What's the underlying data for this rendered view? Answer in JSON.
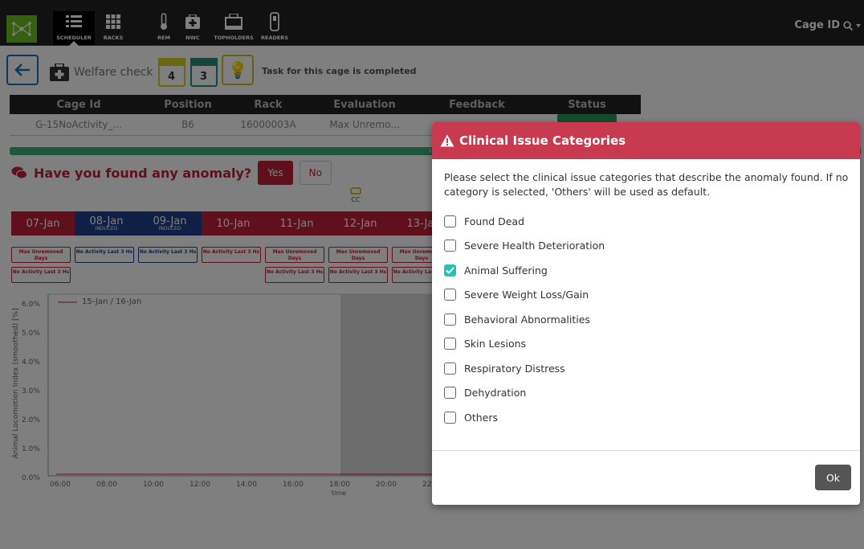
{
  "nav": {
    "items": [
      {
        "id": "scheduler",
        "label": "SCHEDULER",
        "icon": "list-icon",
        "active": true
      },
      {
        "id": "racks",
        "label": "RACKS",
        "icon": "grid-icon",
        "active": false
      },
      {
        "id": "rem",
        "label": "REM",
        "icon": "thermometer-icon",
        "active": false
      },
      {
        "id": "nwc",
        "label": "NWC",
        "icon": "medkit-icon",
        "active": false
      },
      {
        "id": "topholders",
        "label": "TOPHOLDERS",
        "icon": "topholder-icon",
        "active": false
      },
      {
        "id": "readers",
        "label": "READERS",
        "icon": "reader-icon",
        "active": false
      }
    ],
    "search_label": "Cage ID"
  },
  "toolbar": {
    "welfare_label": "Welfare check",
    "cal1": "4",
    "cal2": "3",
    "task_status": "Task for this cage is completed"
  },
  "cage_table": {
    "headers": [
      "Cage Id",
      "Position",
      "Rack",
      "Evaluation",
      "Feedback",
      "Status"
    ],
    "row": [
      "G-15NoActivity_...",
      "B6",
      "16000003A",
      "Max Unremo...",
      "",
      ""
    ]
  },
  "progress": {
    "value": 100,
    "label": "100%"
  },
  "anomaly": {
    "question": "Have you found any anomaly?",
    "yes": "Yes",
    "no": "No",
    "cc": "CC"
  },
  "days": [
    {
      "label": "07-Jan",
      "sub": "",
      "color": "red"
    },
    {
      "label": "08-Jan",
      "sub": "INDUCED",
      "color": "blue"
    },
    {
      "label": "09-Jan",
      "sub": "INDUCED",
      "color": "blue"
    },
    {
      "label": "10-Jan",
      "sub": "",
      "color": "red"
    },
    {
      "label": "11-Jan",
      "sub": "",
      "color": "red"
    },
    {
      "label": "12-Jan",
      "sub": "",
      "color": "red"
    },
    {
      "label": "13-Jan",
      "sub": "",
      "color": "red"
    }
  ],
  "tags": {
    "max_unremoved": "Max Unremoved Days",
    "no_activity": "No Activity Last 3 Hs"
  },
  "chart": {
    "legend": "15-Jan / 16-Jan",
    "ylabel": "Animal Locomotion Index (smoothed) [%]",
    "xlabel": "time",
    "yticks": [
      "6.0%",
      "5.0%",
      "4.0%",
      "3.0%",
      "2.0%",
      "1.0%",
      "0.0%"
    ],
    "xticks": [
      "06:00",
      "08:00",
      "10:00",
      "12:00",
      "14:00",
      "16:00",
      "18:00",
      "20:00",
      "22"
    ]
  },
  "modal": {
    "title": "Clinical Issue Categories",
    "description": "Please select the clinical issue categories that describe the anomaly found. If no category is selected, 'Others' will be used as default.",
    "options": [
      {
        "label": "Found Dead",
        "checked": false
      },
      {
        "label": "Severe Health Deterioration",
        "checked": false
      },
      {
        "label": "Animal Suffering",
        "checked": true
      },
      {
        "label": "Severe Weight Loss/Gain",
        "checked": false
      },
      {
        "label": "Behavioral Abnormalities",
        "checked": false
      },
      {
        "label": "Skin Lesions",
        "checked": false
      },
      {
        "label": "Respiratory Distress",
        "checked": false
      },
      {
        "label": "Dehydration",
        "checked": false
      },
      {
        "label": "Others",
        "checked": false
      }
    ],
    "ok_label": "Ok"
  }
}
